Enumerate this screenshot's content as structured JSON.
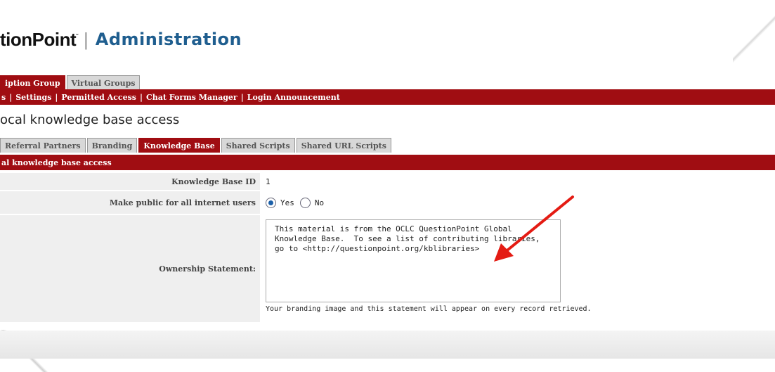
{
  "header": {
    "brand": "tionPoint",
    "brand_mark": "˜",
    "separator": "|",
    "section": "Administration"
  },
  "top_tabs": [
    {
      "label": "iption Group",
      "active": true
    },
    {
      "label": "Virtual Groups",
      "active": false
    }
  ],
  "nav_links": [
    "s",
    "Settings",
    "Permitted Access",
    "Chat Forms Manager",
    "Login Announcement"
  ],
  "page_title": "ocal knowledge base access",
  "sub_tabs": [
    {
      "label": "Referral Partners",
      "active": false
    },
    {
      "label": "Branding",
      "active": false
    },
    {
      "label": "Knowledge Base",
      "active": true
    },
    {
      "label": "Shared Scripts",
      "active": false
    },
    {
      "label": "Shared URL Scripts",
      "active": false
    }
  ],
  "section_bar": "al knowledge base access",
  "form": {
    "kb_id_label": "Knowledge Base ID",
    "kb_id_value": "1",
    "public_label": "Make public for all internet users",
    "public_yes": "Yes",
    "public_no": "No",
    "public_selected": "Yes",
    "ownership_label": "Ownership Statement:",
    "ownership_text": "This material is from the OCLC QuestionPoint Global\nKnowledge Base.  To see a list of contributing libraries,\ngo to <http://questionpoint.org/kblibraries>",
    "ownership_hint": "Your branding image and this statement will appear on every record retrieved."
  },
  "colors": {
    "accent_red": "#a00d12",
    "brand_blue": "#1f5e8f",
    "arrow_red": "#e41b13"
  }
}
